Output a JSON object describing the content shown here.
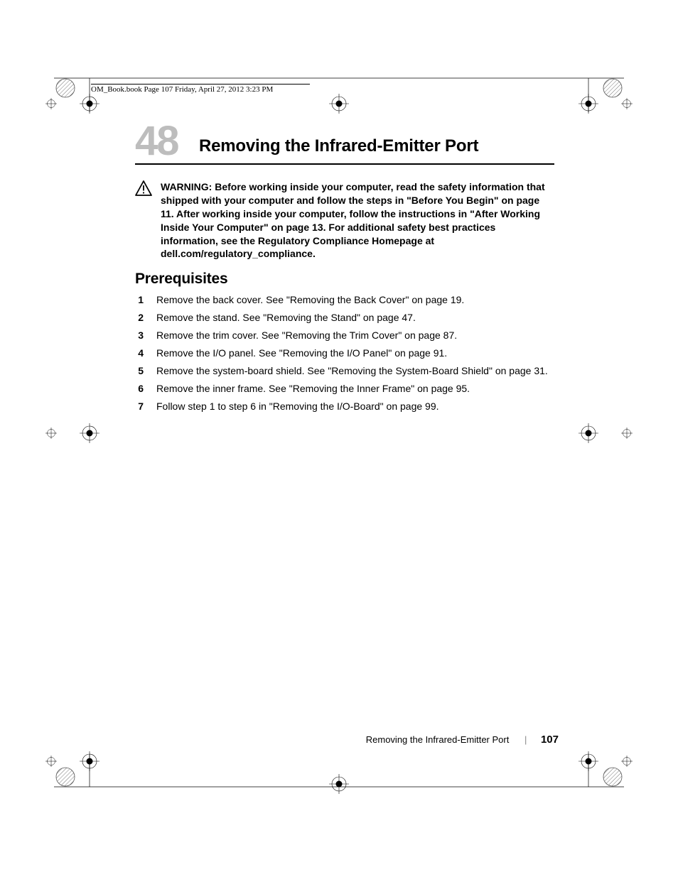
{
  "print_header": "OM_Book.book  Page 107  Friday, April 27, 2012  3:23 PM",
  "chapter": {
    "number": "48",
    "title": "Removing the Infrared-Emitter Port"
  },
  "warning": {
    "label": "WARNING:  ",
    "text": "Before working inside your computer, read the safety information that shipped with your computer and follow the steps in \"Before You Begin\" on page 11. After working inside your computer, follow the instructions in \"After Working Inside Your Computer\" on page 13. For additional safety best practices information, see the Regulatory Compliance Homepage at dell.com/regulatory_compliance."
  },
  "section_heading": "Prerequisites",
  "steps": [
    {
      "n": "1",
      "t": "Remove the back cover. See \"Removing the Back Cover\" on page 19."
    },
    {
      "n": "2",
      "t": "Remove the stand. See \"Removing the Stand\" on page 47."
    },
    {
      "n": "3",
      "t": "Remove the trim cover. See \"Removing the Trim Cover\" on page 87."
    },
    {
      "n": "4",
      "t": "Remove the I/O panel. See \"Removing the I/O Panel\" on page 91."
    },
    {
      "n": "5",
      "t": "Remove the system-board shield. See \"Removing the System-Board Shield\" on page 31."
    },
    {
      "n": "6",
      "t": "Remove the inner frame. See \"Removing the Inner Frame\" on page 95."
    },
    {
      "n": "7",
      "t": "Follow step 1 to step 6 in \"Removing the I/O-Board\" on page 99."
    }
  ],
  "footer": {
    "title": "Removing the Infrared-Emitter Port",
    "page": "107"
  }
}
